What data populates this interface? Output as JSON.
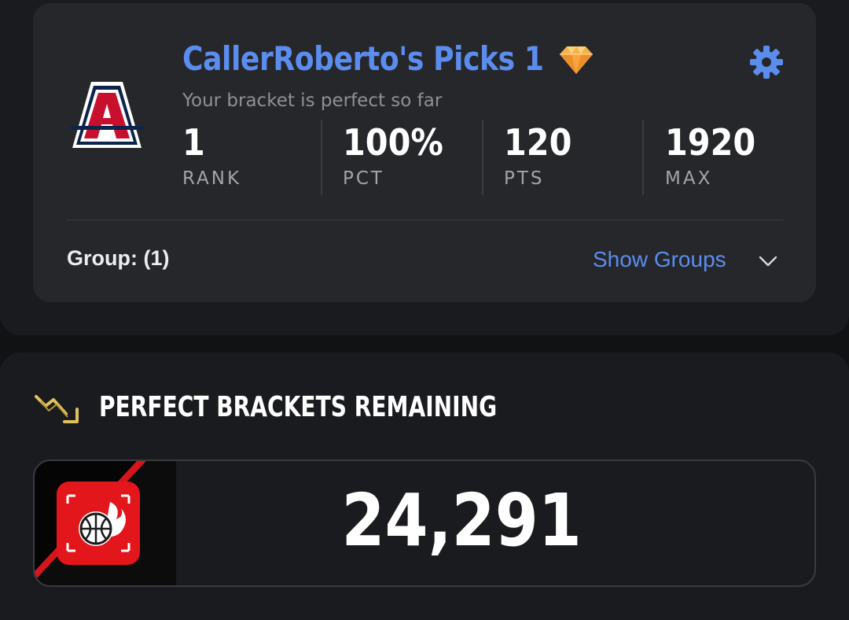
{
  "bracket": {
    "title": "CallerRoberto's Picks 1",
    "subtitle": "Your bracket is perfect so far",
    "team_logo_letter": "A",
    "icons": {
      "badge": "gem-icon",
      "settings": "gear-icon",
      "expand": "chevron-down-icon"
    },
    "stats": [
      {
        "value": "1",
        "label": "RANK"
      },
      {
        "value": "100%",
        "label": "PCT"
      },
      {
        "value": "120",
        "label": "PTS"
      },
      {
        "value": "1920",
        "label": "MAX"
      }
    ],
    "group_label": "Group: (1)",
    "show_groups_label": "Show Groups"
  },
  "perfect_brackets": {
    "title": "PERFECT BRACKETS REMAINING",
    "count": "24,291",
    "icons": {
      "section": "trending-down-icon",
      "card": "flaming-basketball-icon"
    }
  },
  "colors": {
    "accent": "#5b8def",
    "background": "#111214",
    "panel": "#1a1b1e",
    "card": "#26272b",
    "team_red": "#c8102e",
    "team_navy": "#0c234b",
    "trend_gold": "#e0c15a"
  }
}
